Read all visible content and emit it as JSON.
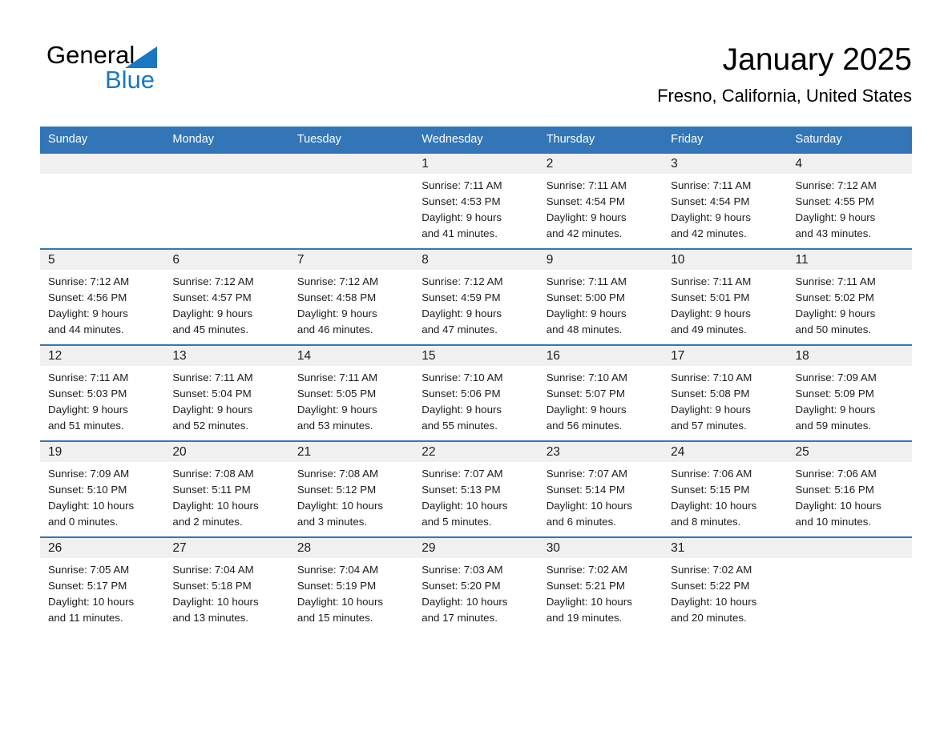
{
  "brand": {
    "line1": "General",
    "line2": "Blue",
    "triangle_color": "#1a78c2"
  },
  "header": {
    "title": "January 2025",
    "subtitle": "Fresno, California, United States"
  },
  "theme": {
    "header_blue": "#3276b8",
    "brand_blue": "#1a78c2",
    "daynum_band": "#f0f0f0",
    "text": "#1c1c1c"
  },
  "weekday_headers": [
    "Sunday",
    "Monday",
    "Tuesday",
    "Wednesday",
    "Thursday",
    "Friday",
    "Saturday"
  ],
  "labels": {
    "sunrise_prefix": "Sunrise:",
    "sunset_prefix": "Sunset:",
    "daylight_prefix": "Daylight:"
  },
  "weeks": [
    [
      {
        "day": "",
        "sunrise": "",
        "sunset": "",
        "daylight_a": "",
        "daylight_b": ""
      },
      {
        "day": "",
        "sunrise": "",
        "sunset": "",
        "daylight_a": "",
        "daylight_b": ""
      },
      {
        "day": "",
        "sunrise": "",
        "sunset": "",
        "daylight_a": "",
        "daylight_b": ""
      },
      {
        "day": "1",
        "sunrise": "Sunrise: 7:11 AM",
        "sunset": "Sunset: 4:53 PM",
        "daylight_a": "Daylight: 9 hours",
        "daylight_b": "and 41 minutes."
      },
      {
        "day": "2",
        "sunrise": "Sunrise: 7:11 AM",
        "sunset": "Sunset: 4:54 PM",
        "daylight_a": "Daylight: 9 hours",
        "daylight_b": "and 42 minutes."
      },
      {
        "day": "3",
        "sunrise": "Sunrise: 7:11 AM",
        "sunset": "Sunset: 4:54 PM",
        "daylight_a": "Daylight: 9 hours",
        "daylight_b": "and 42 minutes."
      },
      {
        "day": "4",
        "sunrise": "Sunrise: 7:12 AM",
        "sunset": "Sunset: 4:55 PM",
        "daylight_a": "Daylight: 9 hours",
        "daylight_b": "and 43 minutes."
      }
    ],
    [
      {
        "day": "5",
        "sunrise": "Sunrise: 7:12 AM",
        "sunset": "Sunset: 4:56 PM",
        "daylight_a": "Daylight: 9 hours",
        "daylight_b": "and 44 minutes."
      },
      {
        "day": "6",
        "sunrise": "Sunrise: 7:12 AM",
        "sunset": "Sunset: 4:57 PM",
        "daylight_a": "Daylight: 9 hours",
        "daylight_b": "and 45 minutes."
      },
      {
        "day": "7",
        "sunrise": "Sunrise: 7:12 AM",
        "sunset": "Sunset: 4:58 PM",
        "daylight_a": "Daylight: 9 hours",
        "daylight_b": "and 46 minutes."
      },
      {
        "day": "8",
        "sunrise": "Sunrise: 7:12 AM",
        "sunset": "Sunset: 4:59 PM",
        "daylight_a": "Daylight: 9 hours",
        "daylight_b": "and 47 minutes."
      },
      {
        "day": "9",
        "sunrise": "Sunrise: 7:11 AM",
        "sunset": "Sunset: 5:00 PM",
        "daylight_a": "Daylight: 9 hours",
        "daylight_b": "and 48 minutes."
      },
      {
        "day": "10",
        "sunrise": "Sunrise: 7:11 AM",
        "sunset": "Sunset: 5:01 PM",
        "daylight_a": "Daylight: 9 hours",
        "daylight_b": "and 49 minutes."
      },
      {
        "day": "11",
        "sunrise": "Sunrise: 7:11 AM",
        "sunset": "Sunset: 5:02 PM",
        "daylight_a": "Daylight: 9 hours",
        "daylight_b": "and 50 minutes."
      }
    ],
    [
      {
        "day": "12",
        "sunrise": "Sunrise: 7:11 AM",
        "sunset": "Sunset: 5:03 PM",
        "daylight_a": "Daylight: 9 hours",
        "daylight_b": "and 51 minutes."
      },
      {
        "day": "13",
        "sunrise": "Sunrise: 7:11 AM",
        "sunset": "Sunset: 5:04 PM",
        "daylight_a": "Daylight: 9 hours",
        "daylight_b": "and 52 minutes."
      },
      {
        "day": "14",
        "sunrise": "Sunrise: 7:11 AM",
        "sunset": "Sunset: 5:05 PM",
        "daylight_a": "Daylight: 9 hours",
        "daylight_b": "and 53 minutes."
      },
      {
        "day": "15",
        "sunrise": "Sunrise: 7:10 AM",
        "sunset": "Sunset: 5:06 PM",
        "daylight_a": "Daylight: 9 hours",
        "daylight_b": "and 55 minutes."
      },
      {
        "day": "16",
        "sunrise": "Sunrise: 7:10 AM",
        "sunset": "Sunset: 5:07 PM",
        "daylight_a": "Daylight: 9 hours",
        "daylight_b": "and 56 minutes."
      },
      {
        "day": "17",
        "sunrise": "Sunrise: 7:10 AM",
        "sunset": "Sunset: 5:08 PM",
        "daylight_a": "Daylight: 9 hours",
        "daylight_b": "and 57 minutes."
      },
      {
        "day": "18",
        "sunrise": "Sunrise: 7:09 AM",
        "sunset": "Sunset: 5:09 PM",
        "daylight_a": "Daylight: 9 hours",
        "daylight_b": "and 59 minutes."
      }
    ],
    [
      {
        "day": "19",
        "sunrise": "Sunrise: 7:09 AM",
        "sunset": "Sunset: 5:10 PM",
        "daylight_a": "Daylight: 10 hours",
        "daylight_b": "and 0 minutes."
      },
      {
        "day": "20",
        "sunrise": "Sunrise: 7:08 AM",
        "sunset": "Sunset: 5:11 PM",
        "daylight_a": "Daylight: 10 hours",
        "daylight_b": "and 2 minutes."
      },
      {
        "day": "21",
        "sunrise": "Sunrise: 7:08 AM",
        "sunset": "Sunset: 5:12 PM",
        "daylight_a": "Daylight: 10 hours",
        "daylight_b": "and 3 minutes."
      },
      {
        "day": "22",
        "sunrise": "Sunrise: 7:07 AM",
        "sunset": "Sunset: 5:13 PM",
        "daylight_a": "Daylight: 10 hours",
        "daylight_b": "and 5 minutes."
      },
      {
        "day": "23",
        "sunrise": "Sunrise: 7:07 AM",
        "sunset": "Sunset: 5:14 PM",
        "daylight_a": "Daylight: 10 hours",
        "daylight_b": "and 6 minutes."
      },
      {
        "day": "24",
        "sunrise": "Sunrise: 7:06 AM",
        "sunset": "Sunset: 5:15 PM",
        "daylight_a": "Daylight: 10 hours",
        "daylight_b": "and 8 minutes."
      },
      {
        "day": "25",
        "sunrise": "Sunrise: 7:06 AM",
        "sunset": "Sunset: 5:16 PM",
        "daylight_a": "Daylight: 10 hours",
        "daylight_b": "and 10 minutes."
      }
    ],
    [
      {
        "day": "26",
        "sunrise": "Sunrise: 7:05 AM",
        "sunset": "Sunset: 5:17 PM",
        "daylight_a": "Daylight: 10 hours",
        "daylight_b": "and 11 minutes."
      },
      {
        "day": "27",
        "sunrise": "Sunrise: 7:04 AM",
        "sunset": "Sunset: 5:18 PM",
        "daylight_a": "Daylight: 10 hours",
        "daylight_b": "and 13 minutes."
      },
      {
        "day": "28",
        "sunrise": "Sunrise: 7:04 AM",
        "sunset": "Sunset: 5:19 PM",
        "daylight_a": "Daylight: 10 hours",
        "daylight_b": "and 15 minutes."
      },
      {
        "day": "29",
        "sunrise": "Sunrise: 7:03 AM",
        "sunset": "Sunset: 5:20 PM",
        "daylight_a": "Daylight: 10 hours",
        "daylight_b": "and 17 minutes."
      },
      {
        "day": "30",
        "sunrise": "Sunrise: 7:02 AM",
        "sunset": "Sunset: 5:21 PM",
        "daylight_a": "Daylight: 10 hours",
        "daylight_b": "and 19 minutes."
      },
      {
        "day": "31",
        "sunrise": "Sunrise: 7:02 AM",
        "sunset": "Sunset: 5:22 PM",
        "daylight_a": "Daylight: 10 hours",
        "daylight_b": "and 20 minutes."
      },
      {
        "day": "",
        "sunrise": "",
        "sunset": "",
        "daylight_a": "",
        "daylight_b": ""
      }
    ]
  ]
}
